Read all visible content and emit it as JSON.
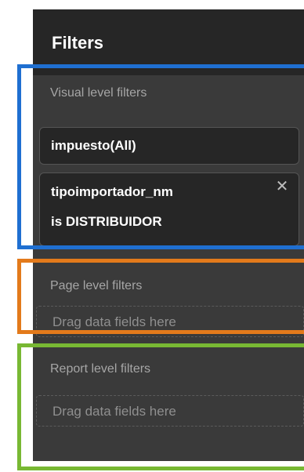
{
  "pane": {
    "title": "Filters"
  },
  "visual_level": {
    "label": "Visual level filters",
    "filters": [
      {
        "name": "impuesto(All)"
      },
      {
        "name": "tipoimportador_nm",
        "condition": "is DISTRIBUIDOR",
        "close_icon": "close-icon"
      }
    ]
  },
  "page_level": {
    "label": "Page level filters",
    "dropzone": "Drag data fields here"
  },
  "report_level": {
    "label": "Report level filters",
    "dropzone": "Drag data fields here"
  },
  "highlight_colors": {
    "visual": "#1f6fd1",
    "page": "#e37a1b",
    "report": "#78b833"
  }
}
